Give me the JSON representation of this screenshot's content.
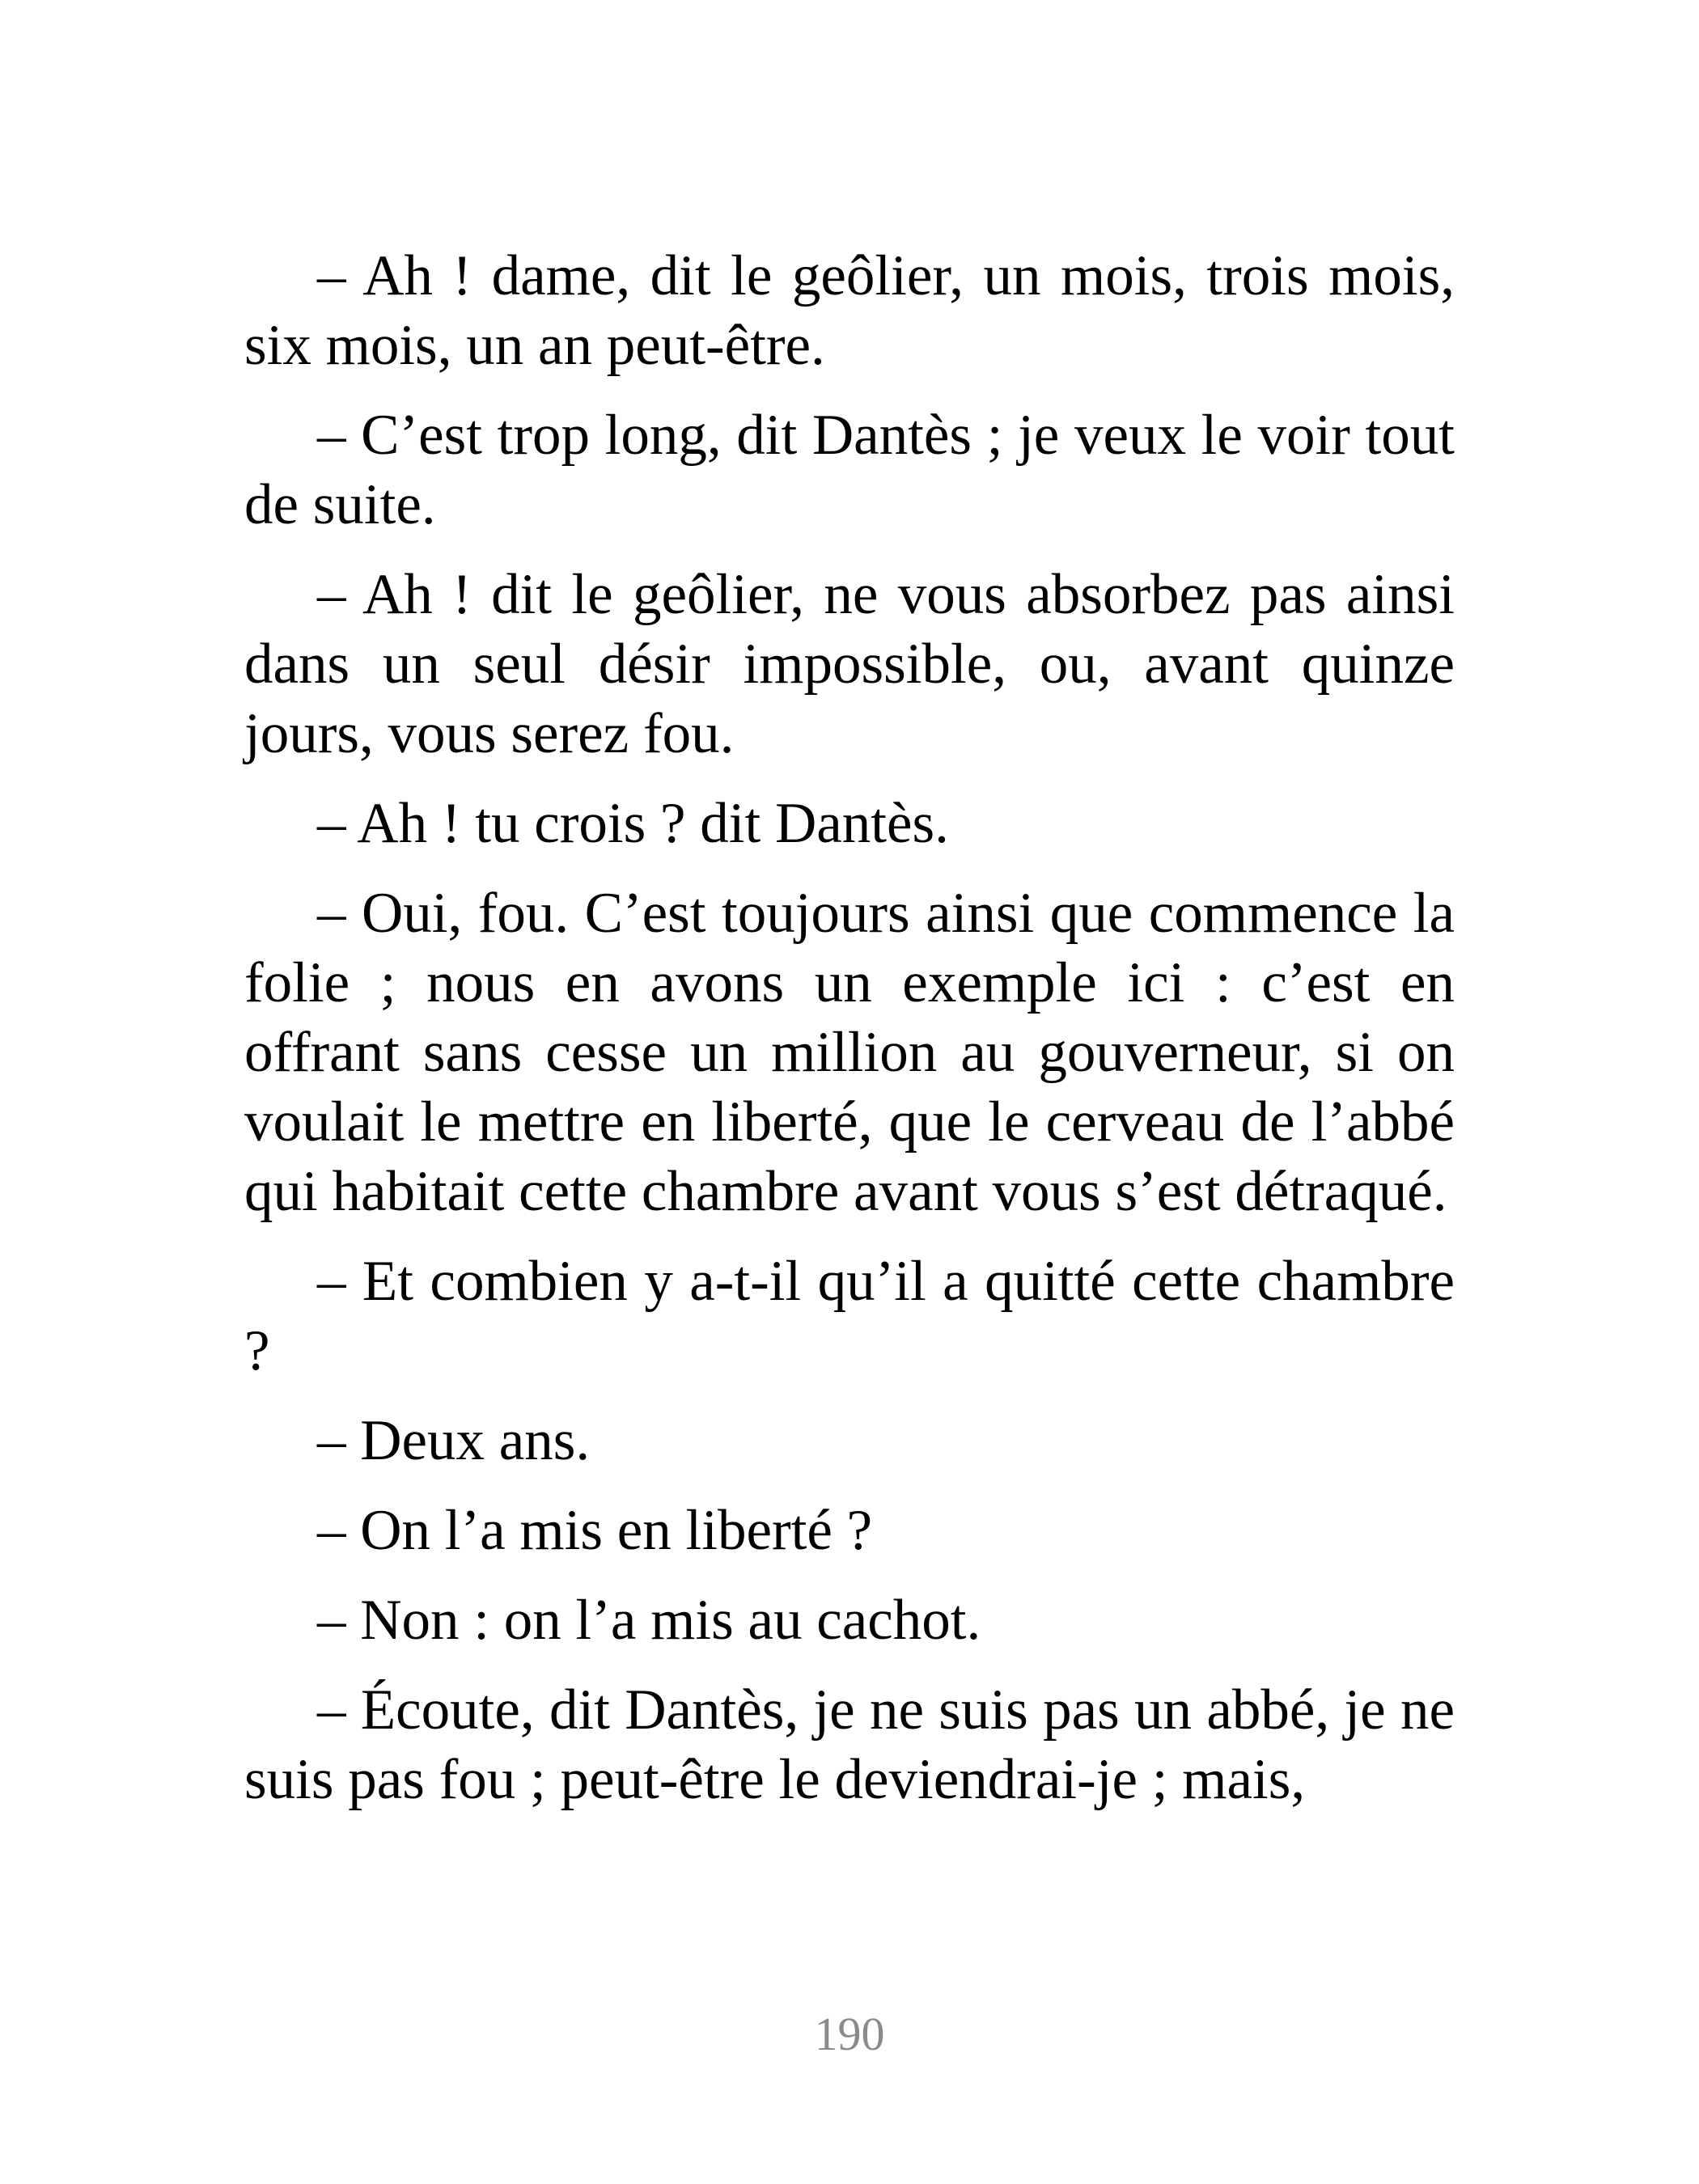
{
  "paragraphs": [
    "– Ah ! dame, dit le geôlier, un mois, trois mois, six mois, un an peut-être.",
    "– C’est trop long, dit Dantès ; je veux le voir tout de suite.",
    "– Ah ! dit le geôlier, ne vous absorbez pas ainsi dans un seul désir impossible, ou, avant quinze jours, vous serez fou.",
    "– Ah ! tu crois ? dit Dantès.",
    "– Oui, fou. C’est toujours ainsi que commence la folie ; nous en avons un exemple ici : c’est en offrant sans cesse un million au gouverneur, si on voulait le mettre en liberté, que le cerveau de l’abbé qui habitait cette chambre avant vous s’est détraqué.",
    "– Et combien y a-t-il qu’il a quitté cette chambre ?",
    "– Deux ans.",
    "– On l’a mis en liberté ?",
    "– Non : on l’a mis au cachot.",
    "– Écoute, dit Dantès, je ne suis pas un abbé, je ne suis pas fou ; peut-être le deviendrai-je ; mais,"
  ],
  "page_number": "190"
}
